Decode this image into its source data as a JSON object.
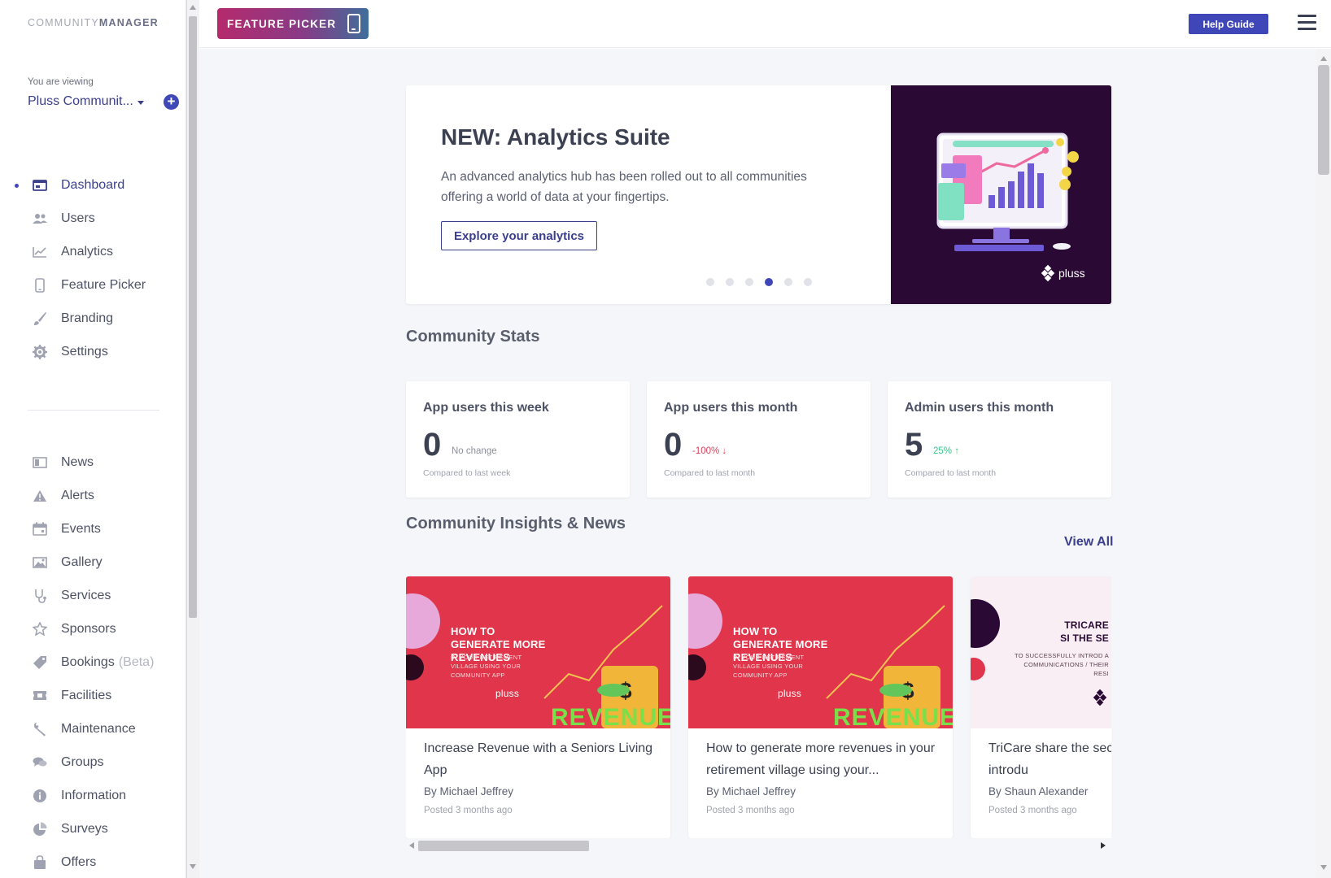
{
  "app": {
    "brand_light": "COMMUNITY",
    "brand_bold": "MANAGER",
    "viewing_label": "You are viewing",
    "community_name": "Pluss Communit...",
    "add_symbol": "+"
  },
  "sidebar": {
    "primary": [
      {
        "label": "Dashboard",
        "icon": "dashboard-icon",
        "active": true
      },
      {
        "label": "Users",
        "icon": "users-icon"
      },
      {
        "label": "Analytics",
        "icon": "analytics-icon"
      },
      {
        "label": "Feature Picker",
        "icon": "phone-icon"
      },
      {
        "label": "Branding",
        "icon": "brush-icon"
      },
      {
        "label": "Settings",
        "icon": "gear-icon"
      }
    ],
    "secondary": [
      {
        "label": "News",
        "icon": "news-icon"
      },
      {
        "label": "Alerts",
        "icon": "alert-icon"
      },
      {
        "label": "Events",
        "icon": "calendar-icon"
      },
      {
        "label": "Gallery",
        "icon": "image-icon"
      },
      {
        "label": "Services",
        "icon": "stethoscope-icon"
      },
      {
        "label": "Sponsors",
        "icon": "star-icon"
      },
      {
        "label": "Bookings",
        "icon": "tag-icon",
        "suffix": "(Beta)"
      },
      {
        "label": "Facilities",
        "icon": "ticket-icon"
      },
      {
        "label": "Maintenance",
        "icon": "wrench-icon"
      },
      {
        "label": "Groups",
        "icon": "chat-icon"
      },
      {
        "label": "Information",
        "icon": "info-icon"
      },
      {
        "label": "Surveys",
        "icon": "pie-icon"
      },
      {
        "label": "Offers",
        "icon": "bag-icon"
      }
    ]
  },
  "topbar": {
    "feature_picker_label": "FEATURE PICKER",
    "help_label": "Help Guide"
  },
  "banner": {
    "title": "NEW: Analytics Suite",
    "description": "An advanced analytics hub has been rolled out to all communities offering a world of data at your fingertips.",
    "button_label": "Explore your analytics",
    "dot_count": 6,
    "active_dot": 3,
    "logo_text": "pluss"
  },
  "stats": {
    "section_title": "Community Stats",
    "cards": [
      {
        "title": "App users this week",
        "value": "0",
        "change": "No change",
        "compare": "Compared to last week",
        "change_color": "#8d909c"
      },
      {
        "title": "App users this month",
        "value": "0",
        "change": "-100% ↓",
        "compare": "Compared to last month",
        "change_color": "#d9435a"
      },
      {
        "title": "Admin users this month",
        "value": "5",
        "change": "25% ↑",
        "compare": "Compared to last month",
        "change_color": "#3fc48a"
      }
    ]
  },
  "news": {
    "section_title": "Community Insights & News",
    "view_all_label": "View All",
    "items": [
      {
        "title": "Increase Revenue with a Seniors Living App",
        "author": "By Michael Jeffrey",
        "date": "Posted 3 months ago",
        "img_headline": "HOW TO GENERATE MORE REVENUES",
        "img_sub": "IN YOUR RETIREMENT VILLAGE USING YOUR COMMUNITY APP",
        "img_logo": "pluss",
        "img_word": "REVENUE"
      },
      {
        "title": "How to generate more revenues in your retirement village using your...",
        "author": "By Michael Jeffrey",
        "date": "Posted 3 months ago",
        "img_headline": "HOW TO GENERATE MORE REVENUES",
        "img_sub": "IN YOUR RETIREMENT VILLAGE USING YOUR COMMUNITY APP",
        "img_logo": "pluss",
        "img_word": "REVENUE"
      },
      {
        "title": "TriCare share the sec successfully introdu",
        "author": "By Shaun Alexander",
        "date": "Posted 3 months ago",
        "img_headline": "TRICARE SI THE SE",
        "img_sub": "TO SUCCESSFULLY INTROD A COMMUNICATIONS / THEIR RESI"
      }
    ]
  },
  "colors": {
    "accent": "#3f46b7",
    "news_red": "#e0354a",
    "banner_dark": "#2a0a34"
  }
}
